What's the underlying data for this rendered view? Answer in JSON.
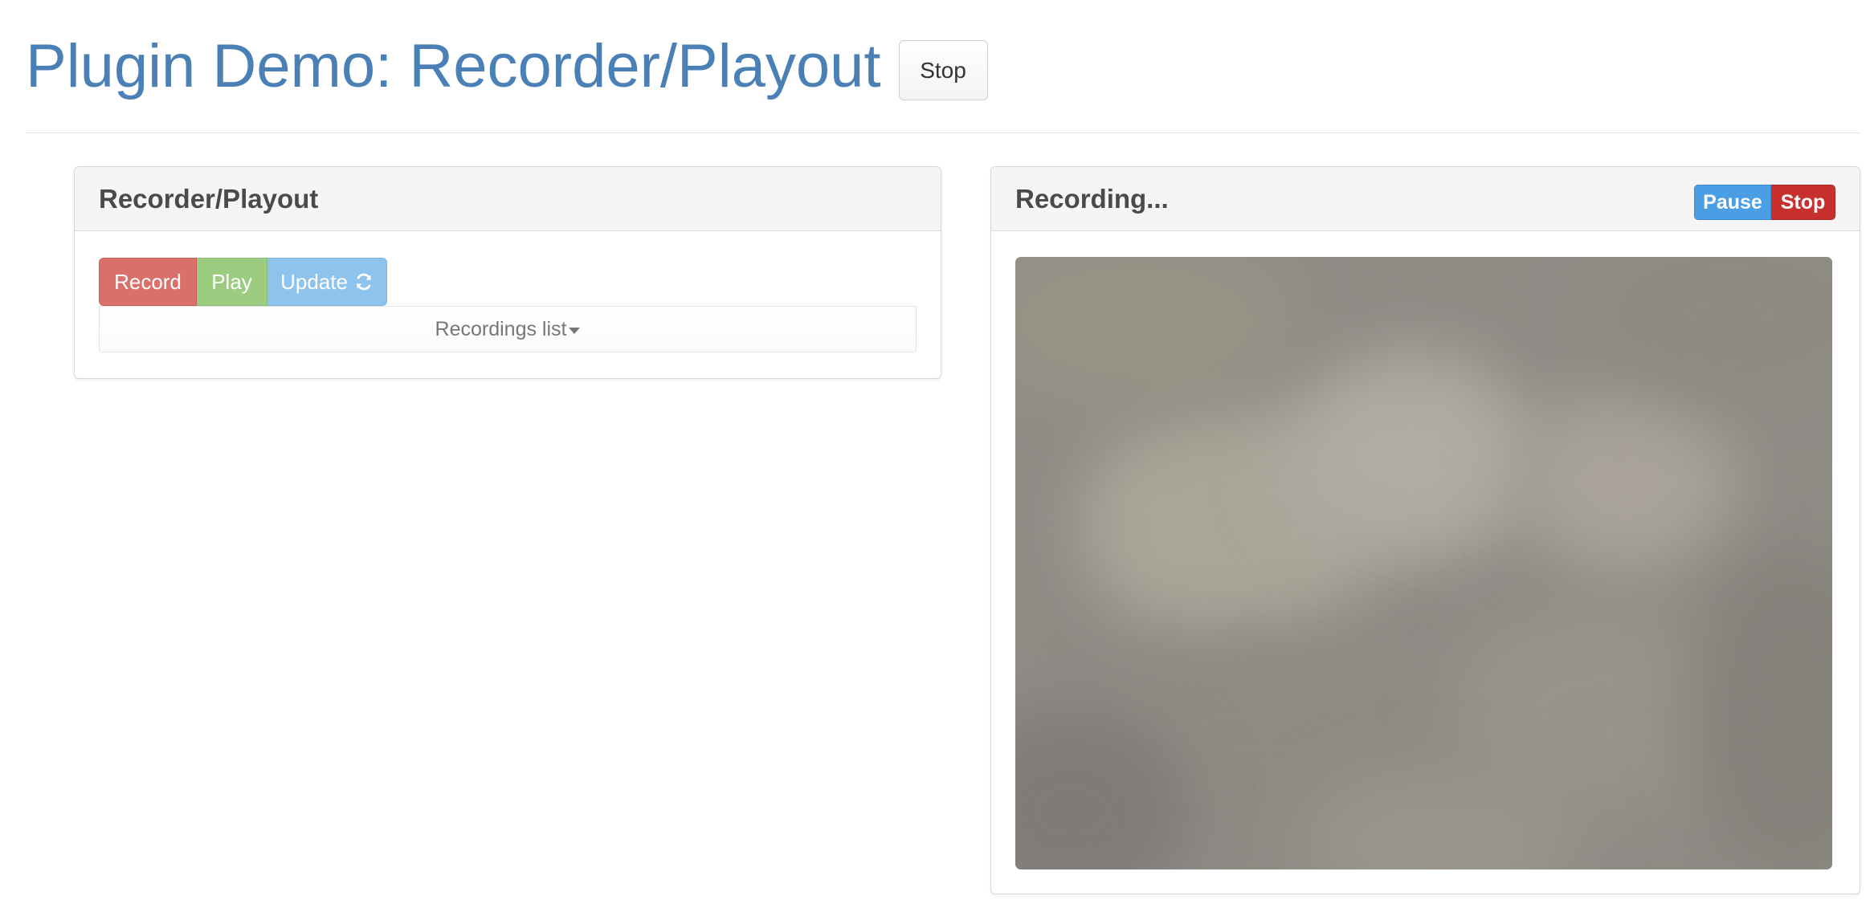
{
  "header": {
    "title": "Plugin Demo: Recorder/Playout",
    "stop_label": "Stop"
  },
  "recorder_panel": {
    "title": "Recorder/Playout",
    "buttons": {
      "record": "Record",
      "play": "Play",
      "update": "Update"
    },
    "recordings_list_label": "Recordings list",
    "icons": {
      "update": "refresh-icon",
      "dropdown": "caret-down-icon"
    }
  },
  "video_panel": {
    "title": "Recording...",
    "pause_label": "Pause",
    "stop_label": "Stop"
  },
  "colors": {
    "title": "#4a80b5",
    "record": "#d9706c",
    "play": "#9ccc7f",
    "update": "#8ec3ed",
    "pause": "#4a9ee3",
    "stop": "#c8302d"
  }
}
